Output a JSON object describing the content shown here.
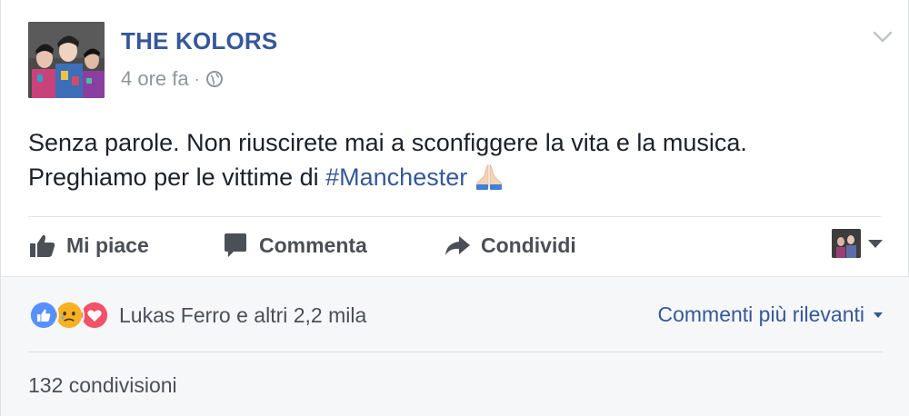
{
  "post": {
    "page_name": "THE KOLORS",
    "timestamp": "4 ore fa",
    "separator": "·",
    "privacy_icon": "globe-icon",
    "text_line1": "Senza parole. Non riuscirete mai a sconfiggere la vita e la musica.",
    "text_line2_prefix": "Preghiamo per le vittime di ",
    "hashtag": "#Manchester",
    "emoji": "folded-hands-emoji"
  },
  "actions": {
    "like_label": "Mi piace",
    "comment_label": "Commenta",
    "share_label": "Condividi"
  },
  "footer": {
    "reactions": [
      "like",
      "sad",
      "love"
    ],
    "reaction_summary": "Lukas Ferro e altri 2,2 mila",
    "sort_label": "Commenti più rilevanti",
    "shares_label": "132 condivisioni"
  },
  "colors": {
    "link": "#365899",
    "text": "#1d2129",
    "muted": "#90949c",
    "action": "#4b4f56",
    "footer_bg": "#f6f7f9",
    "like_blue": "#5890ff",
    "love_red": "#f25268",
    "sad_yellow": "#f7b125"
  }
}
